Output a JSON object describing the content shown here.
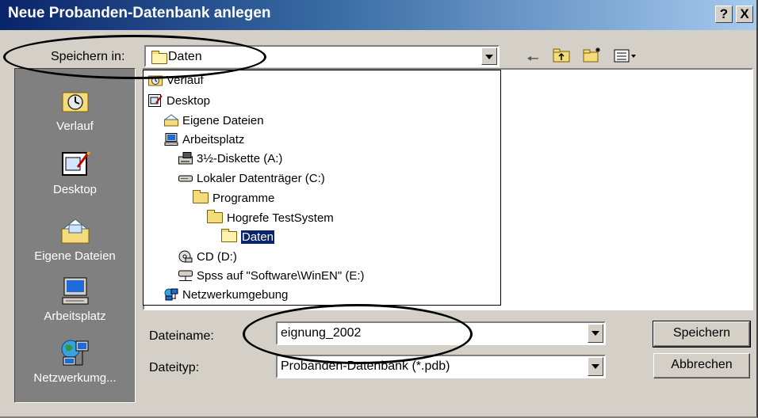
{
  "window": {
    "title": "Neue Probanden-Datenbank anlegen",
    "help_label": "?",
    "close_label": "X"
  },
  "location": {
    "label": "Speichern in:",
    "value": "Daten"
  },
  "toolbar": {
    "icons": [
      "back-arrow-icon",
      "up-folder-icon",
      "new-folder-icon",
      "view-menu-icon"
    ]
  },
  "places": [
    {
      "label": "Verlauf",
      "icon": "history-icon"
    },
    {
      "label": "Desktop",
      "icon": "desktop-icon"
    },
    {
      "label": "Eigene Dateien",
      "icon": "my-documents-icon"
    },
    {
      "label": "Arbeitsplatz",
      "icon": "my-computer-icon"
    },
    {
      "label": "Netzwerkumg...",
      "icon": "network-icon"
    }
  ],
  "dropdown": {
    "items": [
      {
        "label": "Verlauf",
        "indent": 0,
        "icon": "history-icon"
      },
      {
        "label": "Desktop",
        "indent": 0,
        "icon": "desktop-icon"
      },
      {
        "label": "Eigene Dateien",
        "indent": 1,
        "icon": "my-documents-icon"
      },
      {
        "label": "Arbeitsplatz",
        "indent": 1,
        "icon": "my-computer-icon"
      },
      {
        "label": "3½-Diskette (A:)",
        "indent": 2,
        "icon": "floppy-icon"
      },
      {
        "label": "Lokaler Datenträger (C:)",
        "indent": 2,
        "icon": "hard-drive-icon"
      },
      {
        "label": "Programme",
        "indent": 3,
        "icon": "folder-icon"
      },
      {
        "label": "Hogrefe TestSystem",
        "indent": 4,
        "icon": "folder-icon"
      },
      {
        "label": "Daten",
        "indent": 5,
        "icon": "folder-open-icon",
        "selected": true
      },
      {
        "label": "CD (D:)",
        "indent": 2,
        "icon": "cd-drive-icon"
      },
      {
        "label": "Spss auf \"Software\\WinEN\" (E:)",
        "indent": 2,
        "icon": "network-drive-icon"
      },
      {
        "label": "Netzwerkumgebung",
        "indent": 1,
        "icon": "network-icon"
      }
    ]
  },
  "filename": {
    "label": "Dateiname:",
    "value": "eignung_2002"
  },
  "filetype": {
    "label": "Dateityp:",
    "value": "Probanden-Datenbank (*.pdb)"
  },
  "buttons": {
    "save": "Speichern",
    "cancel": "Abbrechen"
  },
  "colors": {
    "titlebar_start": "#0a246a",
    "titlebar_end": "#a6caf0",
    "face": "#d4d0c8",
    "places_bg": "#808080",
    "selection": "#0a246a"
  }
}
